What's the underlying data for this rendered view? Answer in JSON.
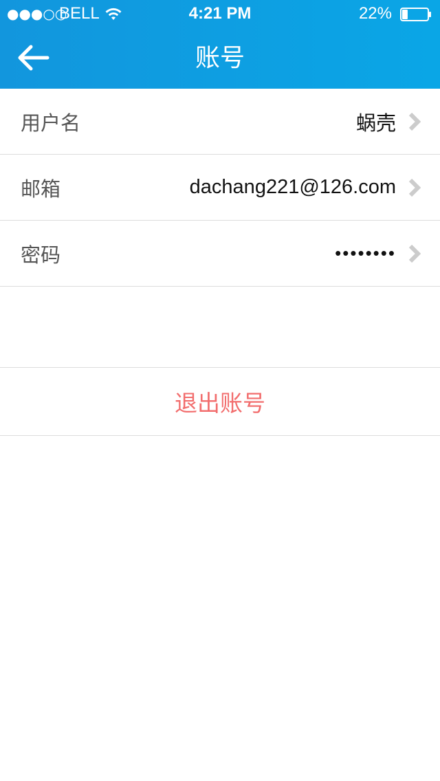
{
  "status_bar": {
    "signal": "●●●○○",
    "carrier": "BELL",
    "time": "4:21 PM",
    "battery": "22%",
    "battery_level": 0.22
  },
  "nav": {
    "title": "账号",
    "back_icon": "arrow-left-icon"
  },
  "rows": [
    {
      "label": "用户名",
      "value": "蜗壳"
    },
    {
      "label": "邮箱",
      "value": "dachang221@126.com"
    },
    {
      "label": "密码",
      "value": "••••••••"
    }
  ],
  "logout_label": "退出账号",
  "colors": {
    "header": "#0aa6e6",
    "logout": "#f26d6d",
    "divider": "#dddddd"
  }
}
